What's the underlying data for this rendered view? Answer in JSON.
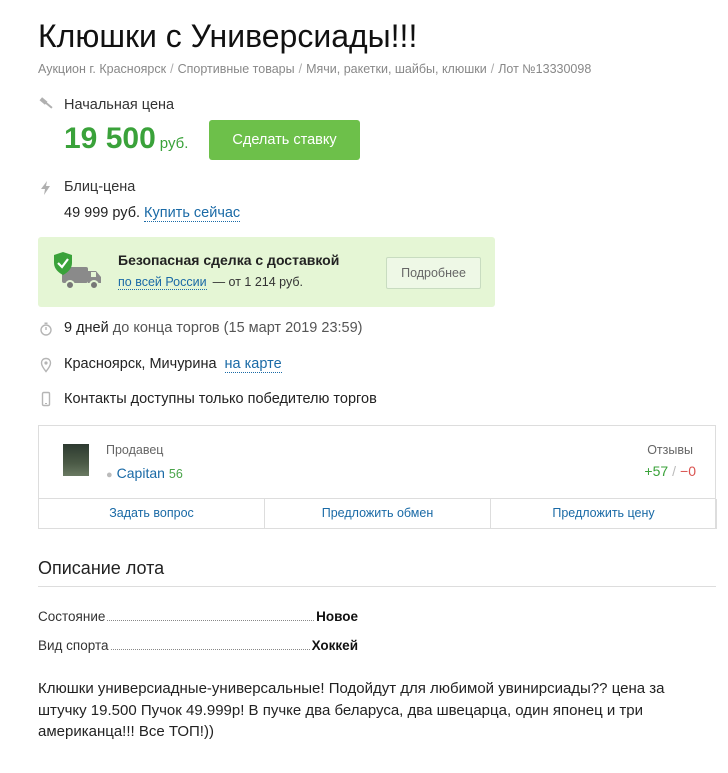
{
  "lot": {
    "title": "Клюшки с Универсиады!!!",
    "breadcrumbs": [
      "Аукцион г. Красноярск",
      "Спортивные товары",
      "Мячи, ракетки, шайбы, клюшки",
      "Лот №13330098"
    ]
  },
  "pricing": {
    "start_label": "Начальная цена",
    "start_value": "19 500",
    "currency": "руб.",
    "bid_button": "Сделать ставку",
    "blitz_label": "Блиц-цена",
    "blitz_value": "49 999 руб.",
    "buy_now": "Купить сейчас"
  },
  "safe_deal": {
    "title": "Безопасная сделка с доставкой",
    "link": "по всей России",
    "price": "— от 1 214 руб.",
    "more_button": "Подробнее"
  },
  "auction_info": {
    "days": "9 дней",
    "until": "до конца торгов",
    "end_date": "(15 март 2019 23:59)",
    "location": "Красноярск, Мичурина",
    "map_link": "на карте",
    "contacts": "Контакты доступны только победителю торгов"
  },
  "seller": {
    "label": "Продавец",
    "name": "Capitan",
    "rating": "56",
    "reviews_label": "Отзывы",
    "reviews_positive": "+57",
    "reviews_separator": "/",
    "reviews_negative": "−0",
    "actions": [
      "Задать вопрос",
      "Предложить обмен",
      "Предложить цену"
    ]
  },
  "description": {
    "heading": "Описание лота",
    "specs": [
      {
        "key": "Состояние",
        "value": "Новое"
      },
      {
        "key": "Вид спорта",
        "value": "Хоккей"
      }
    ],
    "text": "Клюшки универсиадные-универсальные! Подойдут для любимой увинирсиады?? цена за штучку 19.500 Пучок 49.999р! В пучке два беларуса, два швецарца, один японец и три американца!!! Все ТОП!))"
  },
  "colors": {
    "accent_green": "#3aa23a",
    "button_green": "#6dc04a",
    "link_blue": "#1a6aa6",
    "safe_bg": "#e5f6d5"
  }
}
